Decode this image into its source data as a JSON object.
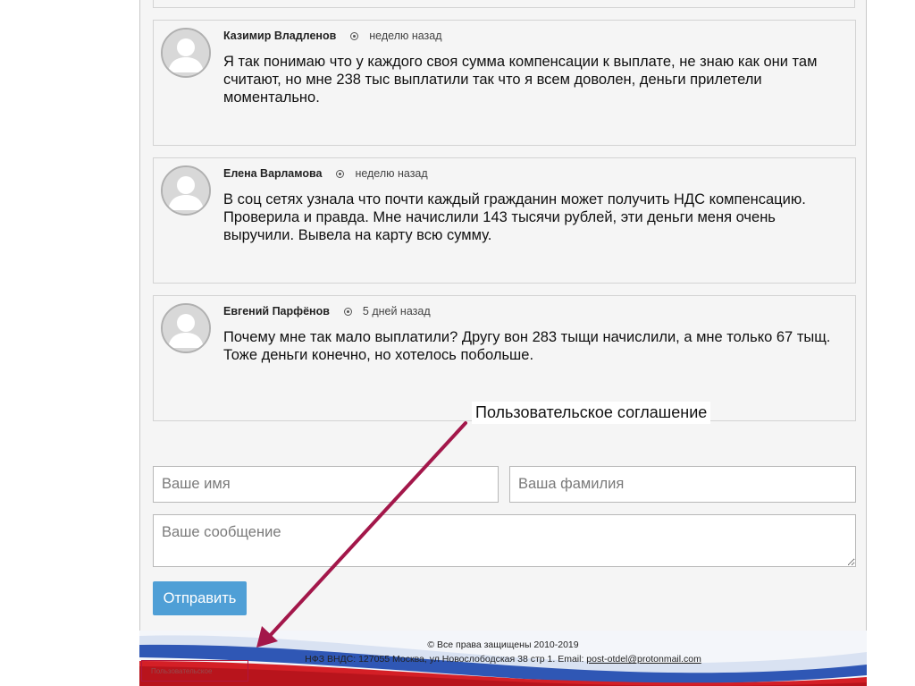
{
  "comments": [
    {
      "author": "Казимир Владленов",
      "time": "неделю назад",
      "text": "Я так понимаю что у каждого своя сумма компенсации к выплате, не знаю как они там считают, но мне 238 тыс выплатили так что я всем доволен, деньги прилетели моментально."
    },
    {
      "author": "Елена Варламова",
      "time": "неделю назад",
      "text": "В соц сетях узнала что почти каждый гражданин может получить НДС компенсацию. Проверила и правда. Мне начислили 143 тысячи рублей, эти деньги меня очень выручили. Вывела на карту всю сумму."
    },
    {
      "author": "Евгений Парфёнов",
      "time": "5 дней назад",
      "text": "Почему мне так мало выплатили? Другу вон 283 тыщи начислили, а мне только 67 тыщ. Тоже деньги конечно, но хотелось побольше."
    }
  ],
  "form": {
    "name_placeholder": "Ваше имя",
    "surname_placeholder": "Ваша фамилия",
    "message_placeholder": "Ваше сообщение",
    "submit_label": "Отправить"
  },
  "footer": {
    "copyright": "© Все права защищены 2010-2019",
    "address": "НФЗ ВНДС: 127055 Москва, ул Новослободская 38 стр 1. Email: ",
    "email": "post-otdel@protonmail.com",
    "faint_link": "Пользовательское"
  },
  "annotation": {
    "label": "Пользовательское соглашение",
    "arrow_color": "#a3174a"
  },
  "colors": {
    "button": "#4f9fd6",
    "panel_bg": "#f5f5f5",
    "border": "#d3d3d3"
  },
  "icons": {
    "avatar": "user-avatar-icon",
    "time": "radio-dot-icon"
  }
}
